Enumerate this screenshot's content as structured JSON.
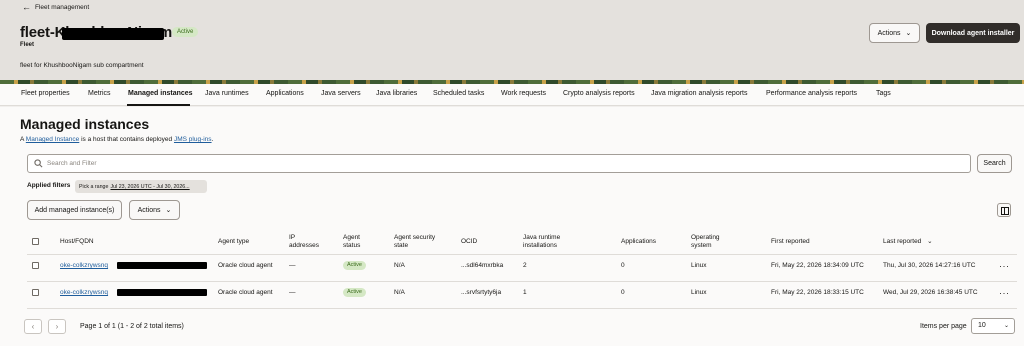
{
  "header": {
    "back_label": "Fleet management",
    "title": "fleet-KhushbooNigam",
    "status": "Active",
    "subtitle": "Fleet",
    "description": "fleet for KhushbooNigam sub compartment",
    "actions_label": "Actions",
    "download_label": "Download agent installer"
  },
  "tabs": [
    "Fleet properties",
    "Metrics",
    "Managed instances",
    "Java runtimes",
    "Applications",
    "Java servers",
    "Java libraries",
    "Scheduled tasks",
    "Work requests",
    "Crypto analysis reports",
    "Java migration analysis reports",
    "Performance analysis reports",
    "Tags"
  ],
  "active_tab": "Managed instances",
  "main": {
    "heading": "Managed instances",
    "intro": {
      "part1": "A ",
      "link1": "Managed Instance",
      "part2": " is a host that contains deployed ",
      "link2": "JMS plug-ins",
      "part3": "."
    },
    "search_placeholder": "Search and Filter",
    "search_button": "Search",
    "applied_filters_label": "Applied filters",
    "filter_chip_prefix": "Pick a range",
    "filter_chip_value": "Jul 23, 2026 UTC - Jul 30, 2026...",
    "add_button": "Add managed instance(s)",
    "actions_label": "Actions"
  },
  "table": {
    "headers": {
      "host": "Host/FQDN",
      "agent_type": "Agent type",
      "ip1": "IP",
      "ip2": "addresses",
      "status1": "Agent",
      "status2": "status",
      "sec1": "Agent security",
      "sec2": "state",
      "ocid": "OCID",
      "runtime1": "Java runtime",
      "runtime2": "installations",
      "apps": "Applications",
      "os1": "Operating",
      "os2": "system",
      "first": "First reported",
      "last": "Last reported"
    },
    "rows": [
      {
        "host": "oke-colkzrywsnq",
        "agent_type": "Oracle cloud agent",
        "ip": "—",
        "status": "Active",
        "security": "N/A",
        "ocid": "...sdl64mxrbka",
        "runtimes": "2",
        "apps": "0",
        "os": "Linux",
        "first": "Fri, May 22, 2026 18:34:09 UTC",
        "last": "Thu, Jul 30, 2026 14:27:16 UTC"
      },
      {
        "host": "oke-colkzrywsnq",
        "agent_type": "Oracle cloud agent",
        "ip": "—",
        "status": "Active",
        "security": "N/A",
        "ocid": "...srvfsrtyty6ja",
        "runtimes": "1",
        "apps": "0",
        "os": "Linux",
        "first": "Fri, May 22, 2026 18:33:15 UTC",
        "last": "Wed, Jul 29, 2026 16:38:45 UTC"
      }
    ]
  },
  "footer": {
    "page_info": "Page 1 of 1 (1 - 2 of 2 total items)",
    "items_per_page_label": "Items per page",
    "items_per_page_value": "10"
  }
}
